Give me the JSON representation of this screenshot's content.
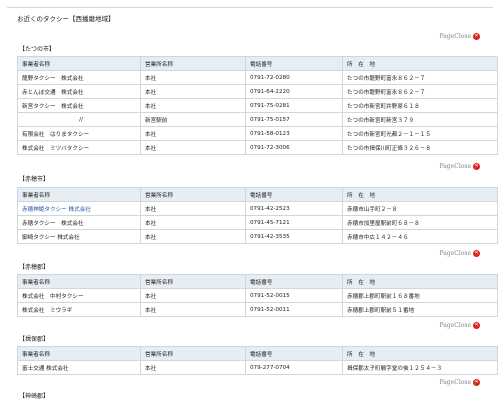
{
  "page_title": "お近くのタクシー【西播磨地域】",
  "close_label": "PageClose",
  "headers": [
    "事業者名称",
    "営業所名称",
    "電話番号",
    "所　在　地"
  ],
  "sections": [
    {
      "title": "【たつの市】",
      "rows": [
        [
          "龍野タクシー　株式会社",
          "本社",
          "0791-72-0280",
          "たつの市龍野町富永８６２－７"
        ],
        [
          "赤とんぼ交通　株式会社",
          "本社",
          "0791-64-2220",
          "たつの市龍野町富永８６２－７"
        ],
        [
          "新宮タクシー　株式会社",
          "本社",
          "0791-75-0281",
          "たつの市新宮町井野原６１８"
        ],
        [
          "//",
          "新宮駅前",
          "0791-75-0157",
          "たつの市新宮町新宮３７９"
        ],
        [
          "有限会社　はりまタクシー",
          "本社",
          "0791-58-0123",
          "たつの市新宮町光都２－１－１５"
        ],
        [
          "株式会社　ミツバタクシー",
          "本社",
          "0791-72-3006",
          "たつの市揖保川町正條３２６－８"
        ]
      ]
    },
    {
      "title": "【赤穂市】",
      "rows": [
        [
          "赤穂神姫タクシー 株式会社",
          "本社",
          "0791-42-2523",
          "赤穂市山手町２－８"
        ],
        [
          "赤穂タクシー　株式会社",
          "本社",
          "0791-45-7121",
          "赤穂市加里屋駅前町６８－８"
        ],
        [
          "御崎タクシー 株式会社",
          "本社",
          "0791-42-3535",
          "赤穂市中広１４２－４６"
        ]
      ]
    },
    {
      "title": "【赤穂郡】",
      "rows": [
        [
          "株式会社　中村タクシー",
          "本社",
          "0791-52-0015",
          "赤穂郡上郡町駅前１６８番地"
        ],
        [
          "株式会社　ミウラギ",
          "本社",
          "0791-52-0011",
          "赤穂郡上郡町駅前５１番地"
        ]
      ]
    },
    {
      "title": "【揖保郡】",
      "rows": [
        [
          "富士交通 株式会社",
          "本社",
          "079-277-0704",
          "揖保郡太子町鵤字堂の後１２５４－３"
        ]
      ]
    },
    {
      "title": "【神崎郡】",
      "rows": []
    }
  ]
}
